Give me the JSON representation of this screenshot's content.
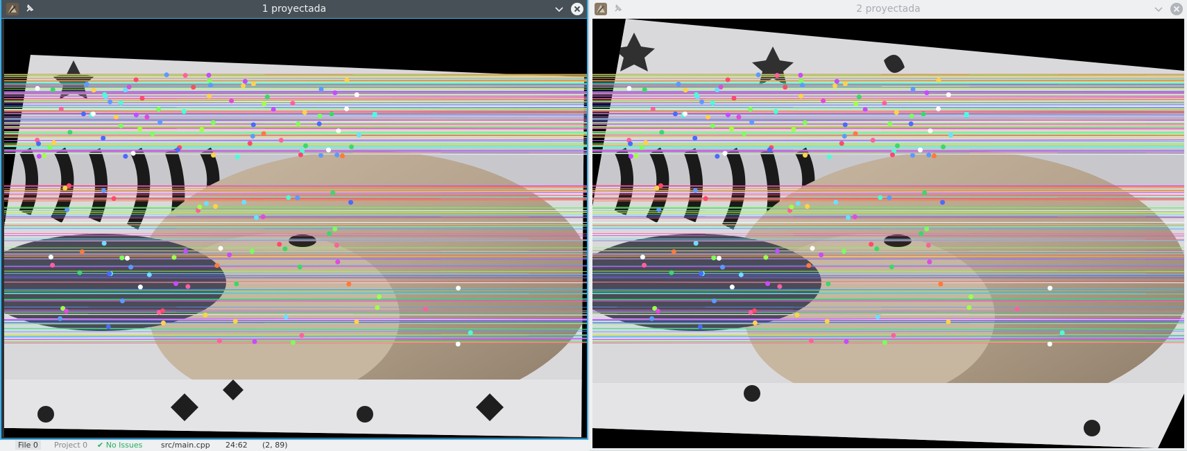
{
  "window_left": {
    "title": "1 proyectada",
    "image_alt": "projected photo with keypoint match lines"
  },
  "window_right": {
    "title": "2 proyectada",
    "image_alt": "second projected photo with keypoint match lines"
  },
  "statusbar": {
    "file_label": "File",
    "file_count": "0",
    "project_label": "Project",
    "project_count": "0",
    "check_glyph": "✔",
    "issues_label": "No Issues",
    "file_path": "src/main.cpp",
    "cursor_pos": "24:62",
    "selection": "(2, 89)"
  },
  "icons": {
    "app": "kde-app-icon",
    "pin": "pin-icon",
    "minimize": "chevron-down-icon",
    "close": "close-icon"
  },
  "colors": {
    "active_border": "#3daee9",
    "active_titlebar": "#475057",
    "inactive_titlebar": "#eff0f1"
  }
}
